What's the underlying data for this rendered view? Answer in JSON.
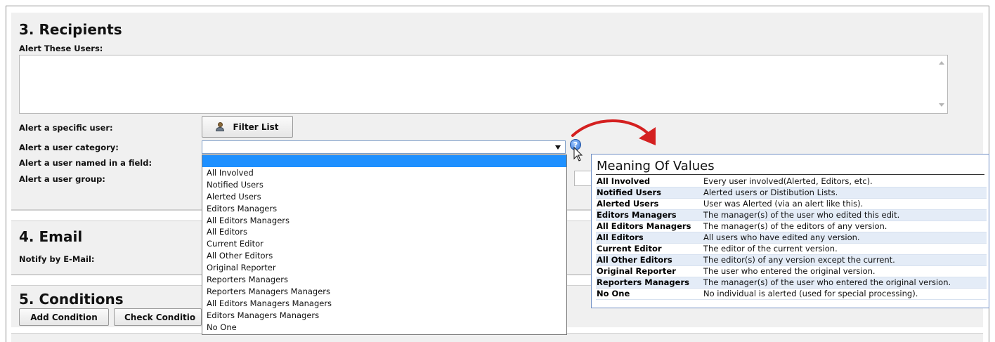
{
  "recipients": {
    "title": "3. Recipients",
    "alert_these_users_label": "Alert These Users:",
    "alert_specific_user_label": "Alert a specific user:",
    "filter_list_label": "Filter List",
    "alert_user_category_label": "Alert a user category:",
    "alert_user_named_in_field_label": "Alert a user named in a field:",
    "alert_user_group_label": "Alert a user group:",
    "category_select_value": "",
    "category_options": [
      "All Involved",
      "Notified Users",
      "Alerted Users",
      "Editors Managers",
      "All Editors Managers",
      "All Editors",
      "Current Editor",
      "All Other Editors",
      "Original Reporter",
      "Reporters Managers",
      "Reporters Managers Managers",
      "All Editors Managers Managers",
      "Editors Managers Managers",
      "No One"
    ]
  },
  "help_icon": {
    "glyph": "?"
  },
  "meaning": {
    "title": "Meaning Of Values",
    "rows": [
      {
        "key": "All Involved",
        "value": "Every user involved(Alerted, Editors, etc)."
      },
      {
        "key": "Notified Users",
        "value": "Alerted users or Distibution Lists."
      },
      {
        "key": "Alerted Users",
        "value": "User was Alerted (via an alert like this)."
      },
      {
        "key": "Editors Managers",
        "value": "The manager(s) of the user who edited this edit."
      },
      {
        "key": "All Editors Managers",
        "value": "The manager(s) of the editors of any version."
      },
      {
        "key": "All Editors",
        "value": "All users who have edited any version."
      },
      {
        "key": "Current Editor",
        "value": "The editor of the current version."
      },
      {
        "key": "All Other Editors",
        "value": "The editor(s) of any version except the current."
      },
      {
        "key": "Original Reporter",
        "value": "The user who entered the original version."
      },
      {
        "key": "Reporters Managers",
        "value": "The manager(s) of the user who entered the original version."
      },
      {
        "key": "No One",
        "value": "No individual is alerted (used for special processing)."
      }
    ]
  },
  "email": {
    "title": "4. Email",
    "notify_label": "Notify by E-Mail:"
  },
  "conditions": {
    "title": "5. Conditions",
    "add_condition_label": "Add Condition",
    "check_conditions_label": "Check Conditio"
  },
  "colors": {
    "section_bg": "#f0f0f0",
    "selected_option": "#1e90ff",
    "arrow_red": "#d42020",
    "meaning_stripe": "#e4ecf7"
  },
  "icons": [
    "person-icon",
    "help-icon",
    "cursor-icon",
    "dropdown-arrow-icon",
    "annotation-arrow-icon"
  ]
}
